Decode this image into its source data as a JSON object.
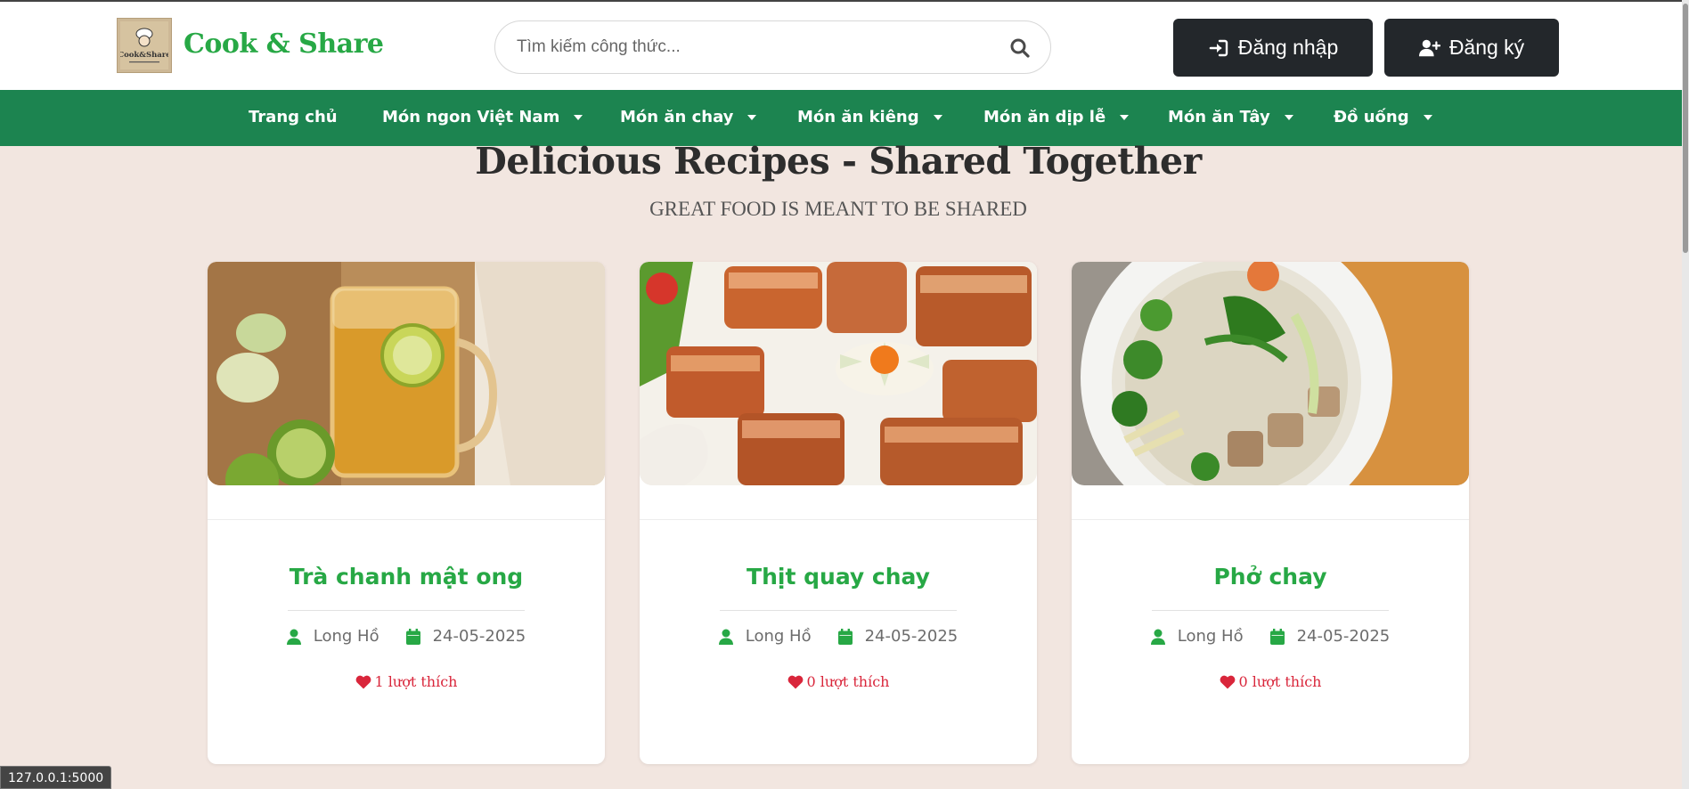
{
  "header": {
    "brand": "Cook & Share",
    "logo_text": "Cook&Share",
    "search_placeholder": "Tìm kiếm công thức...",
    "login_label": "Đăng nhập",
    "register_label": "Đăng ký"
  },
  "nav": {
    "items": [
      {
        "label": "Trang chủ",
        "dropdown": false
      },
      {
        "label": "Món ngon Việt Nam",
        "dropdown": true
      },
      {
        "label": "Món ăn chay",
        "dropdown": true
      },
      {
        "label": "Món ăn kiêng",
        "dropdown": true
      },
      {
        "label": "Món ăn dịp lễ",
        "dropdown": true
      },
      {
        "label": "Món ăn Tây",
        "dropdown": true
      },
      {
        "label": "Đồ uống",
        "dropdown": true
      }
    ]
  },
  "hero": {
    "title": "Delicious Recipes - Shared Together",
    "subtitle": "GREAT FOOD IS MEANT TO BE SHARED"
  },
  "cards": [
    {
      "title": "Trà chanh mật ong",
      "author": "Long Hồ",
      "date": "24-05-2025",
      "likes": "1 lượt thích"
    },
    {
      "title": "Thịt quay chay",
      "author": "Long Hồ",
      "date": "24-05-2025",
      "likes": "0 lượt thích"
    },
    {
      "title": "Phở chay",
      "author": "Long Hồ",
      "date": "24-05-2025",
      "likes": "0 lượt thích"
    }
  ],
  "status_bar": "127.0.0.1:5000",
  "colors": {
    "brand_green": "#27a845",
    "nav_green": "#1c8450",
    "button_dark": "#23272b",
    "like_red": "#d9263b",
    "page_bg": "#f2e6e0"
  },
  "icons": [
    "search-icon",
    "sign-in-icon",
    "user-plus-icon",
    "caret-down-icon",
    "user-icon",
    "calendar-icon",
    "heart-icon"
  ]
}
